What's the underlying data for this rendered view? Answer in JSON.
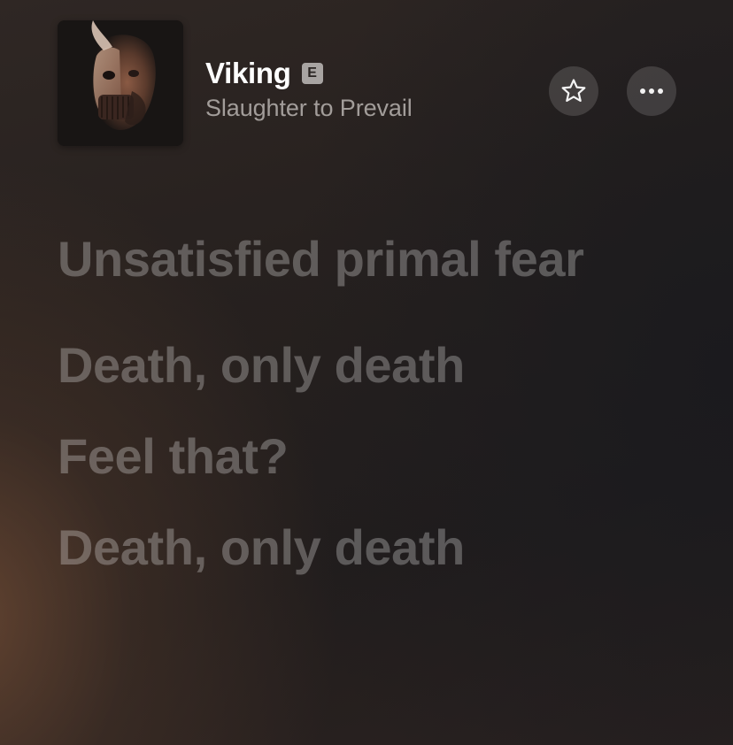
{
  "now_playing": {
    "title": "Viking",
    "explicit_badge": "E",
    "artist": "Slaughter to Prevail",
    "artwork_icon": "album-artwork"
  },
  "actions": {
    "favorite_icon": "star-outline-icon",
    "more_icon": "ellipsis-icon"
  },
  "lyrics": [
    "Unsatisfied primal fear",
    "Death, only death",
    "Feel that?",
    "Death, only death"
  ],
  "colors": {
    "background_top": "#2f2724",
    "background_warm_glow": "#6e4a34",
    "title": "#ffffff",
    "artist": "#a29d9a",
    "lyric_dimmed": "rgba(255,255,255,0.27)",
    "button_fill": "rgba(255,255,255,0.14)"
  }
}
